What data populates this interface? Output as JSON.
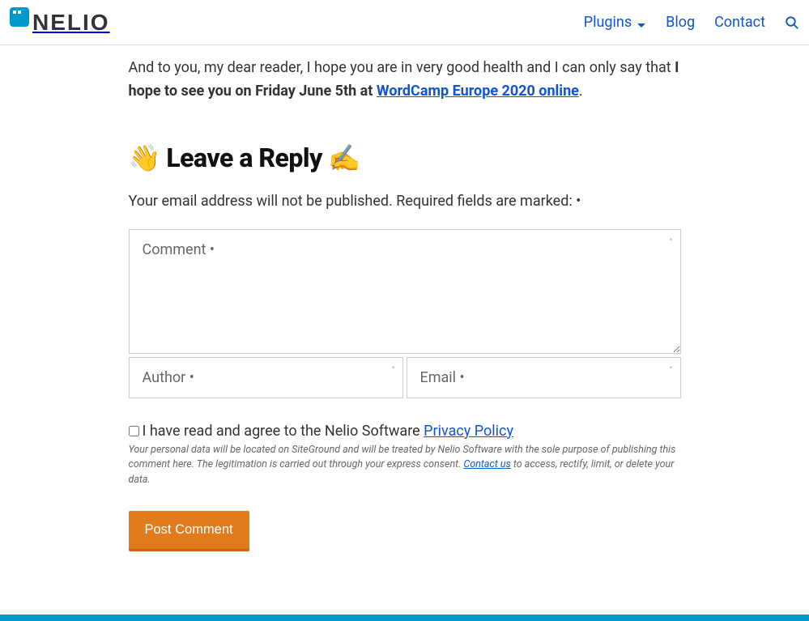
{
  "logo": {
    "text": "NELIO"
  },
  "nav": {
    "plugins": "Plugins",
    "blog": "Blog",
    "contact": "Contact"
  },
  "article": {
    "intro_pre": "And to you, my dear reader, I hope you are in very good health and I can only say that ",
    "intro_bold": "I hope to see you on Friday June 5th at ",
    "intro_link": "WordCamp Europe 2020 online",
    "intro_post": "."
  },
  "reply": {
    "heading": "👋 Leave a Reply ✍",
    "note": "Your email address will not be published. Required fields are marked: •",
    "comment_placeholder": "Comment •",
    "author_placeholder": "Author •",
    "email_placeholder": "Email •",
    "consent_pre": "I have read and agree to the Nelio Software ",
    "consent_link": "Privacy Policy",
    "privacy_text1": "Your personal data will be located on SiteGround and will be treated by Nelio Software with the sole purpose of publishing this comment here. The legitimation is carried out through your express consent. ",
    "privacy_contact": "Contact us",
    "privacy_text2": " to access, rectify, limit, or delete your data.",
    "submit": "Post Comment"
  }
}
